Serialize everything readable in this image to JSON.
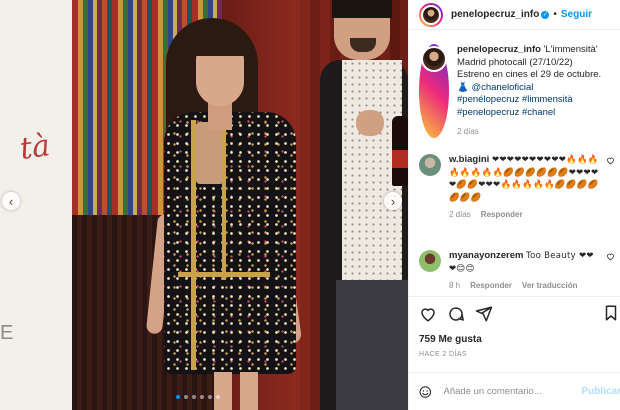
{
  "post": {
    "username": "penelopecruz_info",
    "follow_label": "Seguir",
    "verified_mark": "✓",
    "caption_lines": [
      "'L'immensità'",
      "Madrid photocall (27/10/22)",
      "Estreno en cines el 29 de octubre.",
      "👗 @chaneloficial",
      "#penélopecruz #limmensità",
      "#penelopecruz #chanel"
    ],
    "caption_time": "2 días",
    "likes": "759 Me gusta",
    "posted_ago": "HACE 2 DÍAS"
  },
  "comments": [
    {
      "username": "w.biagini",
      "text": "❤❤❤❤❤❤❤❤❤❤🔥🔥🔥🔥🔥🔥🔥🔥🏉🏉🏉🏉🏉🏉❤❤❤❤❤🏉🏉❤❤❤🔥🔥🔥🔥🔥🏉🏉🏉🏉🏉🏉🏉",
      "time": "2 días",
      "reply_label": "Responder",
      "translation_label": ""
    },
    {
      "username": "myanayonzerem",
      "text": "Too Beauty ❤❤❤😊😊",
      "time": "8 h",
      "reply_label": "Responder",
      "translation_label": "Ver traducción"
    }
  ],
  "composer": {
    "placeholder": "Añade un comentario...",
    "publish_label": "Publicar"
  },
  "media": {
    "bg_script_text": "tà",
    "bg_letter": "E",
    "prev_glyph": "‹",
    "next_glyph": "›",
    "carousel_count": 6,
    "carousel_active_index": 0
  },
  "colors": {
    "accent": "#0095f6",
    "hashtag": "#00376b",
    "muted": "#8e8e8e",
    "publish_disabled": "#b2dffc"
  },
  "icons": {
    "like": "heart-icon",
    "comment": "comment-icon",
    "share": "share-icon",
    "save": "bookmark-icon",
    "emoji": "emoji-icon"
  }
}
